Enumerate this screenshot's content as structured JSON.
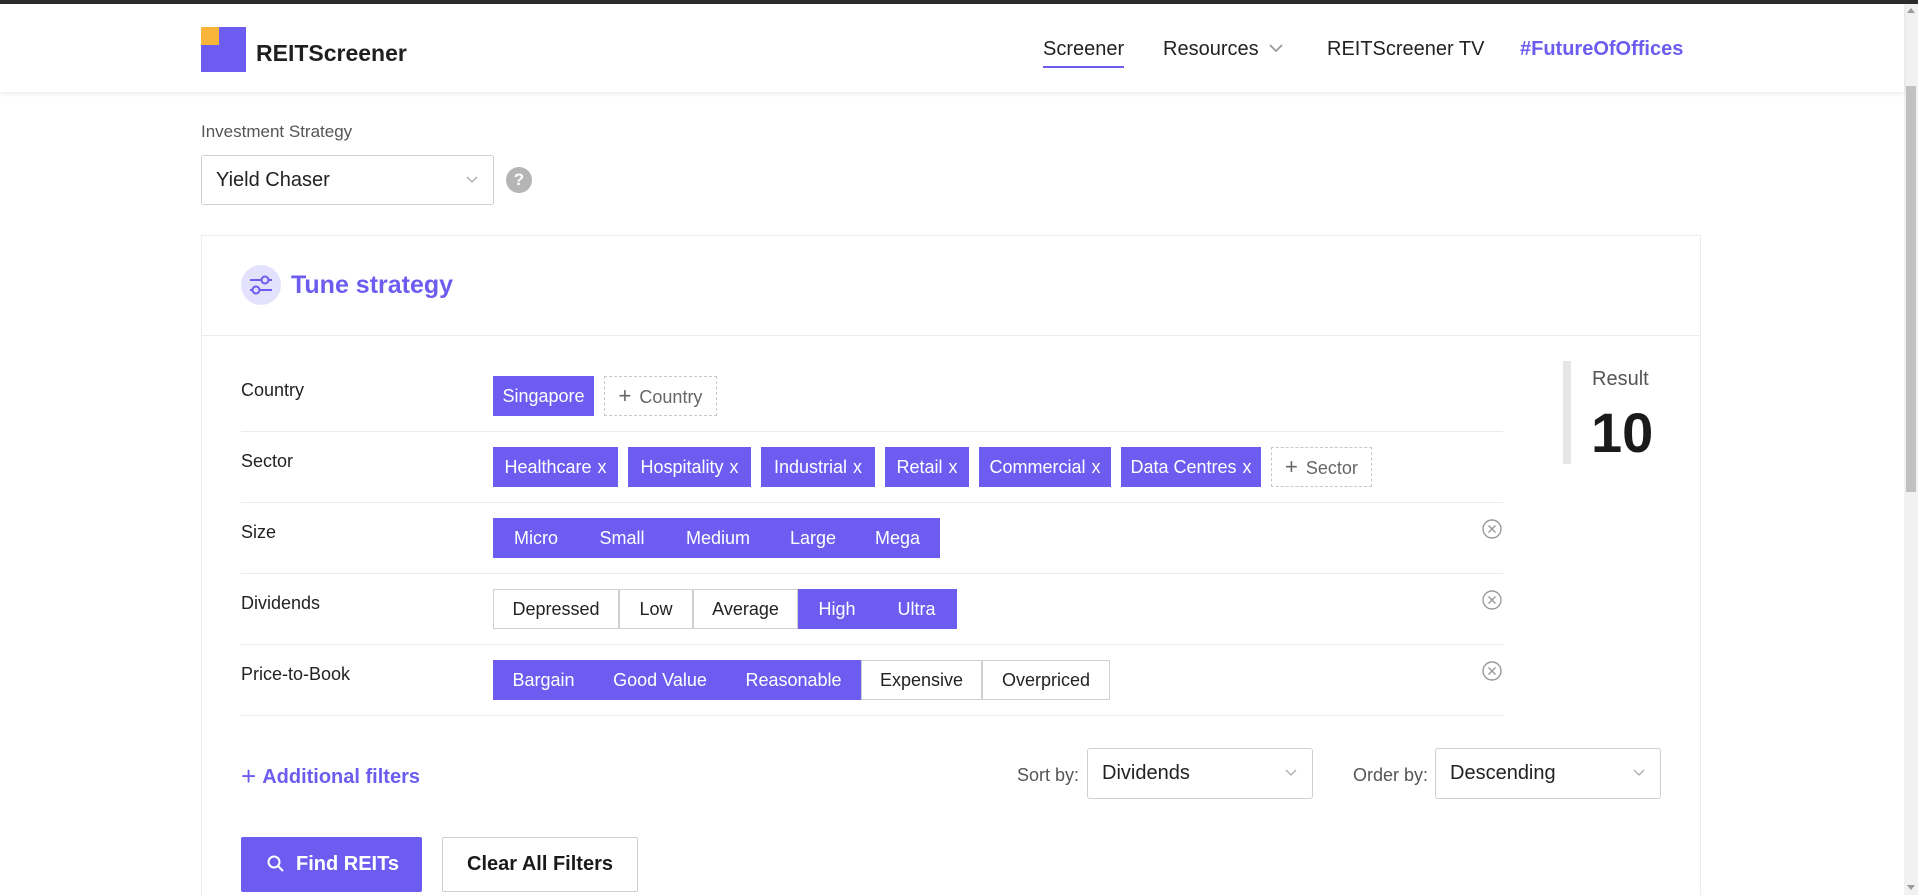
{
  "header": {
    "brand": "REITScreener",
    "nav": {
      "screener": "Screener",
      "resources": "Resources",
      "tv": "REITScreener TV",
      "future": "#FutureOfOffices"
    }
  },
  "strategy": {
    "label": "Investment Strategy",
    "value": "Yield Chaser",
    "help": "?"
  },
  "tune": {
    "title": "Tune strategy",
    "rows": {
      "country": {
        "label": "Country",
        "chips": [
          "Singapore"
        ],
        "add": "Country"
      },
      "sector": {
        "label": "Sector",
        "chips": [
          "Healthcare",
          "Hospitality",
          "Industrial",
          "Retail",
          "Commercial",
          "Data Centres"
        ],
        "add": "Sector"
      },
      "size": {
        "label": "Size",
        "options": [
          "Micro",
          "Small",
          "Medium",
          "Large",
          "Mega"
        ],
        "selected": [
          "Micro",
          "Small",
          "Medium",
          "Large",
          "Mega"
        ]
      },
      "dividends": {
        "label": "Dividends",
        "options": [
          "Depressed",
          "Low",
          "Average",
          "High",
          "Ultra"
        ],
        "selected": [
          "High",
          "Ultra"
        ]
      },
      "ptb": {
        "label": "Price-to-Book",
        "options": [
          "Bargain",
          "Good Value",
          "Reasonable",
          "Expensive",
          "Overpriced"
        ],
        "selected": [
          "Bargain",
          "Good Value",
          "Reasonable"
        ]
      }
    },
    "result": {
      "label": "Result",
      "value": "10"
    },
    "additional_filters": "Additional filters",
    "sort": {
      "label": "Sort by:",
      "value": "Dividends"
    },
    "order": {
      "label": "Order by:",
      "value": "Descending"
    },
    "find_button": "Find REITs",
    "clear_button": "Clear All Filters"
  },
  "colors": {
    "accent": "#6c5cf0",
    "logo_yellow": "#f9b43a"
  }
}
